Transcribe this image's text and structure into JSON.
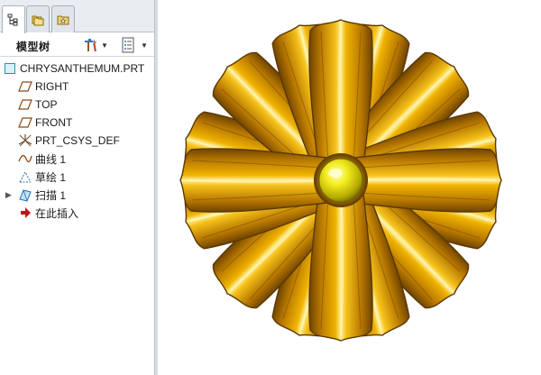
{
  "tabs": [
    {
      "icon": "model-tree-icon",
      "active": true
    },
    {
      "icon": "folder-browser-icon",
      "active": false
    },
    {
      "icon": "favorites-icon",
      "active": false
    }
  ],
  "toolbar": {
    "title": "模型树",
    "settings_icon": "tools-icon",
    "show_icon": "list-settings-icon"
  },
  "tree": {
    "root": "CHRYSANTHEMUM.PRT",
    "items": [
      {
        "label": "RIGHT",
        "icon": "datum-plane-icon"
      },
      {
        "label": "TOP",
        "icon": "datum-plane-icon"
      },
      {
        "label": "FRONT",
        "icon": "datum-plane-icon"
      },
      {
        "label": "PRT_CSYS_DEF",
        "icon": "coordinate-system-icon"
      },
      {
        "label": "曲线 1",
        "icon": "curve-icon"
      },
      {
        "label": "草绘 1",
        "icon": "sketch-icon"
      },
      {
        "label": "扫描 1",
        "icon": "sweep-icon",
        "expandable": true
      },
      {
        "label": "在此插入",
        "icon": "insert-here-arrow-icon"
      }
    ]
  },
  "viewport": {
    "model": "chrysanthemum-flower-model",
    "petal_color": "#d49a00",
    "petal_dark": "#7a4f00",
    "center_color": "#e8e000",
    "background": "#ffffff"
  }
}
